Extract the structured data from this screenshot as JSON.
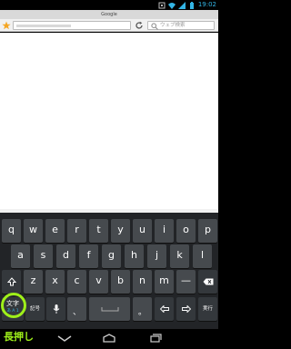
{
  "status_bar": {
    "time": "19:02",
    "icons": [
      "notification-icon",
      "wifi-icon",
      "battery-icon"
    ]
  },
  "browser": {
    "tab_title": "Google",
    "search_placeholder": "ウェブ検索",
    "icons": [
      "bookmark-star-icon",
      "reload-icon",
      "search-icon"
    ]
  },
  "keyboard": {
    "row1": [
      "q",
      "w",
      "e",
      "r",
      "t",
      "y",
      "u",
      "i",
      "o",
      "p"
    ],
    "row2": [
      "a",
      "s",
      "d",
      "f",
      "g",
      "h",
      "j",
      "k",
      "l"
    ],
    "row3": [
      "z",
      "x",
      "c",
      "v",
      "b",
      "n",
      "m",
      "—"
    ],
    "mode_key": {
      "main": "文字",
      "sub": "あ A 1"
    },
    "symbol_key": "記号",
    "comma_key": "、",
    "period_key": "。",
    "enter_key": "実行",
    "icons": [
      "shift-icon",
      "backspace-icon",
      "mic-icon",
      "space-icon",
      "cursor-left-icon",
      "cursor-right-icon"
    ]
  },
  "nav_bar": {
    "icons": [
      "back-icon",
      "home-icon",
      "recent-apps-icon"
    ]
  },
  "caption": "長押し",
  "colors": {
    "accent": "#9ff01a",
    "key": "#464a4e",
    "keyboard_bg": "#222427",
    "status_blue": "#33b5e5"
  }
}
